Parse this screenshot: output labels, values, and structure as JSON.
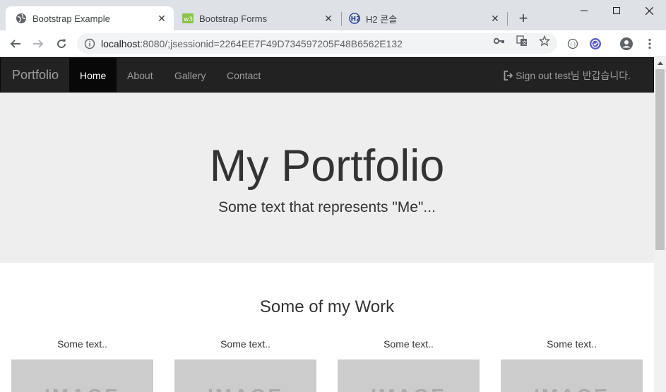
{
  "browser": {
    "tabs": [
      {
        "title": "Bootstrap Example",
        "icon": "globe-icon",
        "active": true
      },
      {
        "title": "Bootstrap Forms",
        "icon": "w3schools-icon",
        "active": false
      },
      {
        "title": "H2 콘솔",
        "icon": "h2-icon",
        "active": false
      }
    ],
    "close_glyph": "✕",
    "new_tab_glyph": "+",
    "url_host": "localhost",
    "url_rest": ":8080/;jsessionid=2264EE7F49D734597205F48B6562E132"
  },
  "nav": {
    "brand": "Portfolio",
    "items": [
      {
        "label": "Home",
        "active": true
      },
      {
        "label": "About"
      },
      {
        "label": "Gallery"
      },
      {
        "label": "Contact"
      }
    ],
    "signout": "Sign out test님 반갑습니다."
  },
  "hero": {
    "title": "My Portfolio",
    "subtitle": "Some text that represents \"Me\"..."
  },
  "work": {
    "title": "Some of my Work",
    "cards": [
      {
        "caption": "Some text..",
        "image_text": "IMAGE"
      },
      {
        "caption": "Some text..",
        "image_text": "IMAGE"
      },
      {
        "caption": "Some text..",
        "image_text": "IMAGE"
      },
      {
        "caption": "Some text..",
        "image_text": "IMAGE"
      }
    ]
  },
  "colors": {
    "navbar_bg": "#222222",
    "jumbotron_bg": "#eeeeee",
    "tabstrip_bg": "#dee1e6"
  }
}
